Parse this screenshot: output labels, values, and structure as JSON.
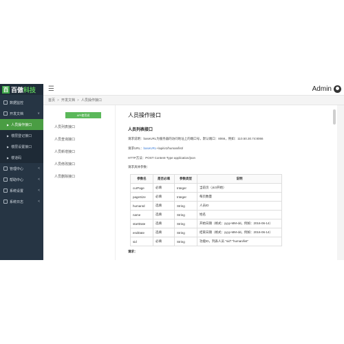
{
  "logo": {
    "mark": "百",
    "name_a": "百傲",
    "name_b": "科技"
  },
  "sidebar": {
    "items": [
      {
        "label": "数据监控",
        "caret": ""
      },
      {
        "label": "开发文档",
        "caret": "∨"
      }
    ],
    "sub_items": [
      {
        "label": "人员操作接口",
        "active": true
      },
      {
        "label": "楼层登记接口",
        "active": false
      },
      {
        "label": "楼层设置接口",
        "active": false
      },
      {
        "label": "楼道码",
        "active": false
      }
    ],
    "items_after": [
      {
        "label": "管理中心",
        "caret": "<"
      },
      {
        "label": "帮助中心",
        "caret": "<"
      },
      {
        "label": "系统设置",
        "caret": "<"
      },
      {
        "label": "系统日志",
        "caret": "<"
      }
    ]
  },
  "header": {
    "menu_icon": "☰",
    "admin_label": "Admin"
  },
  "breadcrumb": [
    "首页",
    "开发文档",
    "人员操作接口"
  ],
  "left_panel": {
    "api_button": "API使用说",
    "list": [
      "人员列表接口",
      "人员查询接口",
      "人员新增接口",
      "人员修改接口",
      "人员删除接口"
    ]
  },
  "doc": {
    "title": "人员操作接口",
    "section_title": "人员列表接口",
    "p1": "请求说明：baseURL为服务器的访问地址上的端口号，默认端口：8066，例如：110.50.30.74:8066",
    "p2_prefix": "请求URL：",
    "p2_link": "baseURL",
    "p2_suffix": "+/api/v1/human/list/",
    "p3": "HTTP方法：POST Content-Type application/json",
    "p4": "请求具体参数：",
    "table": {
      "headers": [
        "参数名",
        "是否必填",
        "参数类型",
        "说明"
      ],
      "rows": [
        [
          "curPage",
          "必填",
          "Integer",
          "当前页（从0开始）"
        ],
        [
          "pageSize",
          "必填",
          "Integer",
          "每页数量"
        ],
        [
          "humanId",
          "选填",
          "String",
          "人员ID"
        ],
        [
          "name",
          "选填",
          "String",
          "姓名"
        ],
        [
          "startDate",
          "选填",
          "String",
          "开始日期（格式：yyyy-MM-dd，例如：2016-06-14）"
        ],
        [
          "endDate",
          "选填",
          "String",
          "结束日期（格式：yyyy-MM-dd，例如：2016-06-14）"
        ],
        [
          "sid",
          "必填",
          "String",
          "功能ID，列表人员 \"sid\":\"human/list\""
        ]
      ]
    },
    "request_label": "请求："
  }
}
